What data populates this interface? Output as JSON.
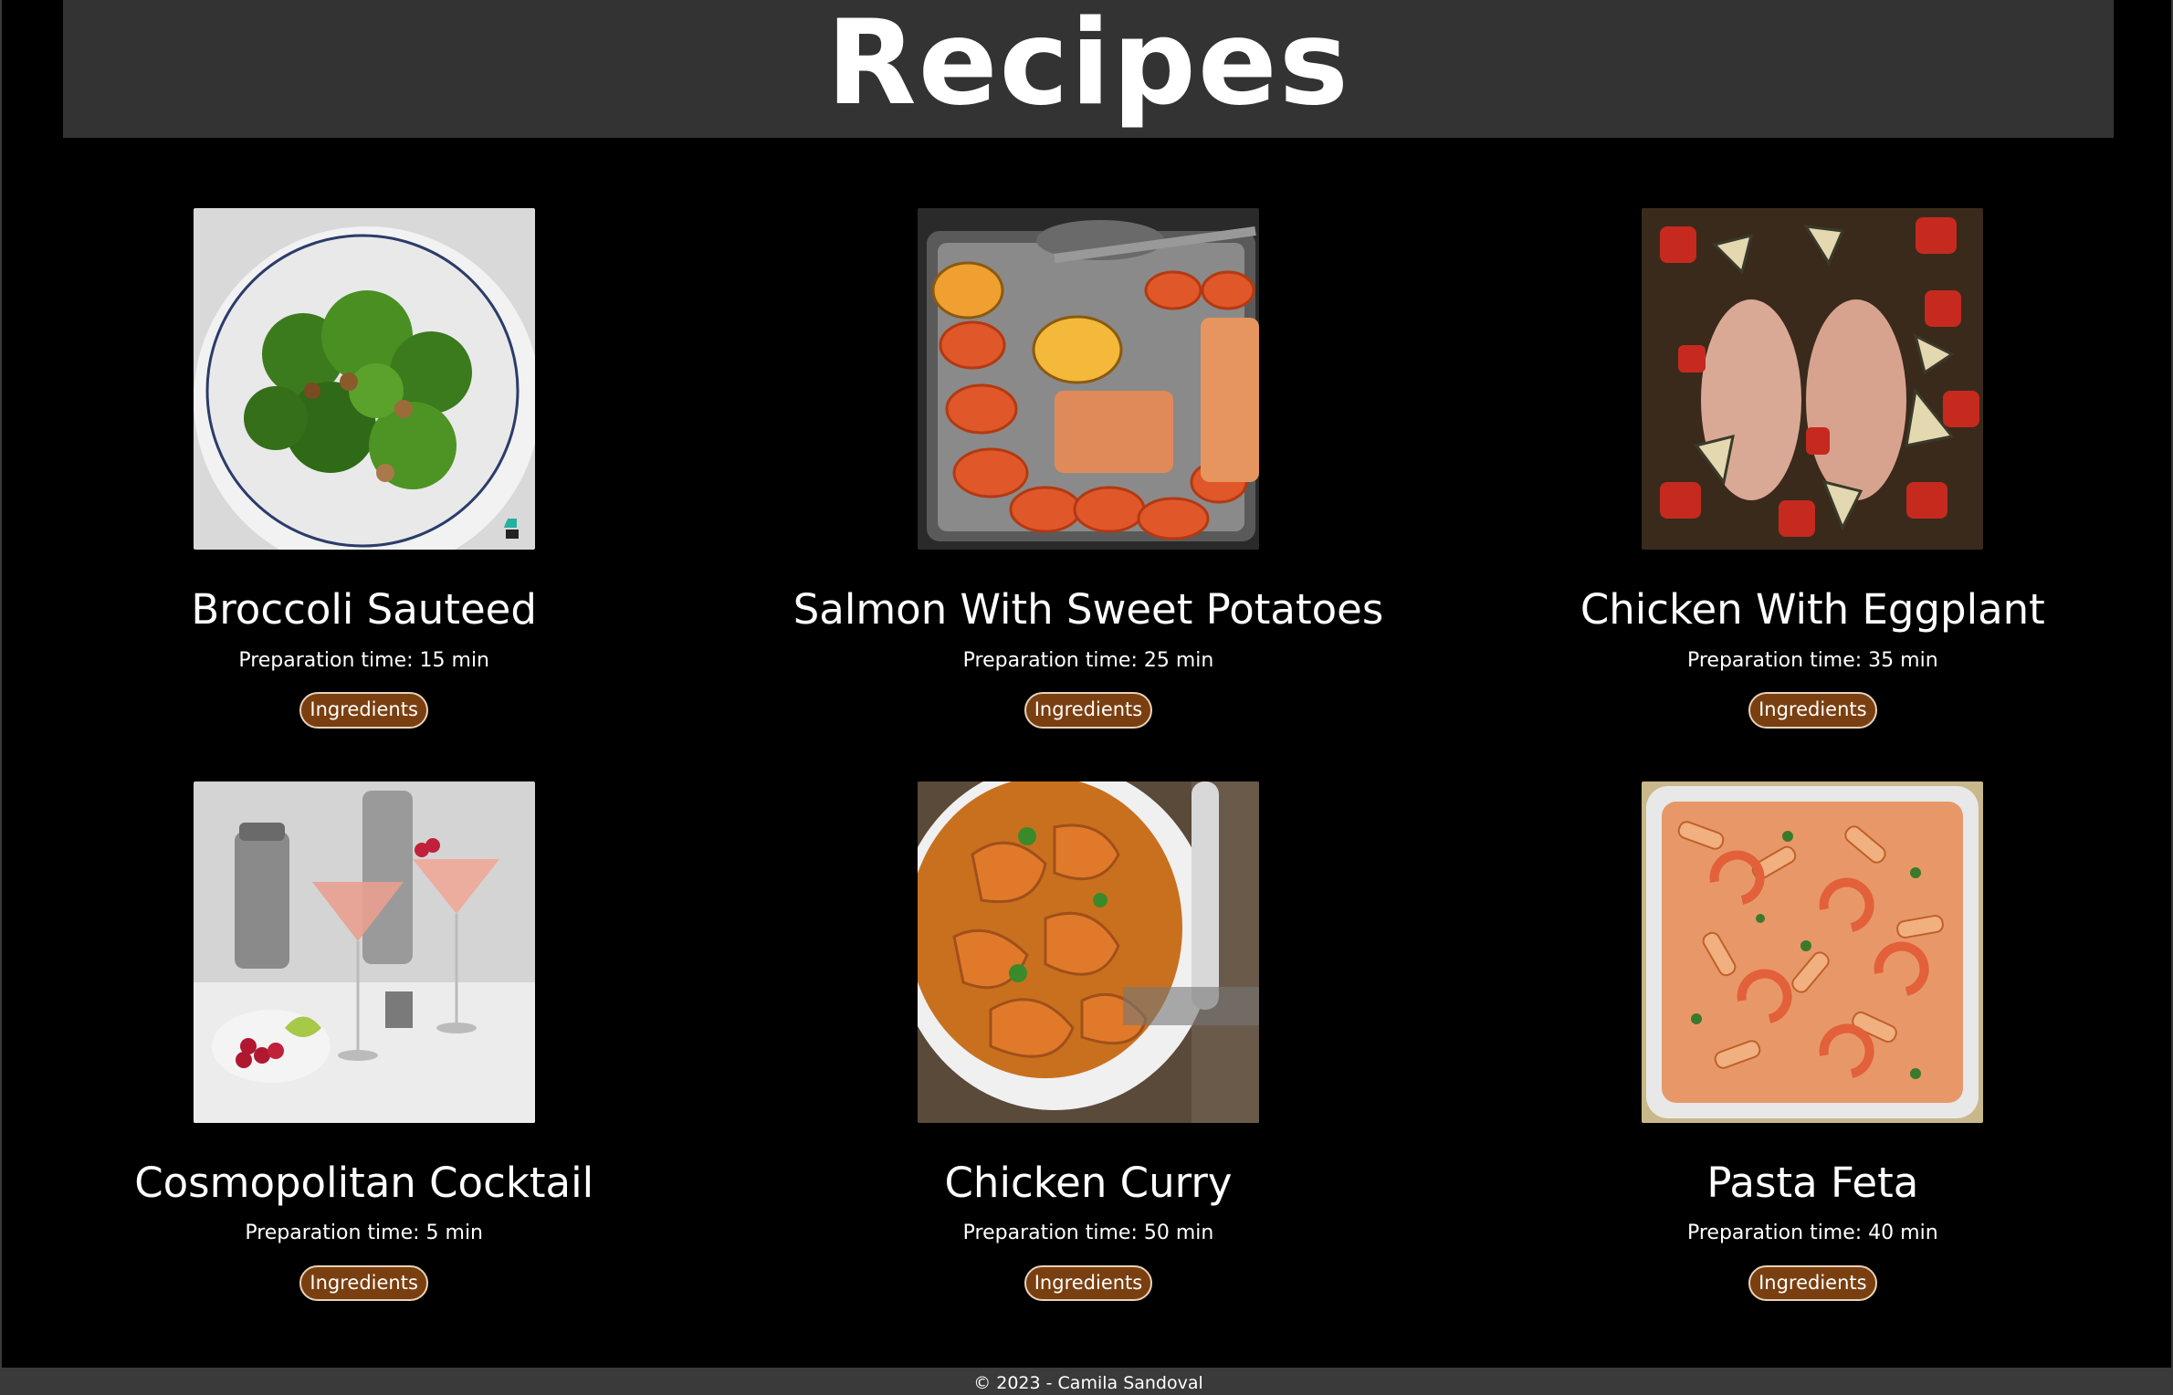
{
  "header": {
    "title": "Recipes"
  },
  "recipes": [
    {
      "title": "Broccoli Sauteed",
      "prep": "Preparation time: 15 min",
      "button": "Ingredients",
      "image": "broccoli-dish"
    },
    {
      "title": "Salmon With Sweet Potatoes",
      "prep": "Preparation time: 25 min",
      "button": "Ingredients",
      "image": "salmon-tray"
    },
    {
      "title": "Chicken With Eggplant",
      "prep": "Preparation time: 35 min",
      "button": "Ingredients",
      "image": "chicken-eggplant"
    },
    {
      "title": "Cosmopolitan Cocktail",
      "prep": "Preparation time: 5 min",
      "button": "Ingredients",
      "image": "cocktails"
    },
    {
      "title": "Chicken Curry",
      "prep": "Preparation time: 50 min",
      "button": "Ingredients",
      "image": "curry-bowl"
    },
    {
      "title": "Pasta Feta",
      "prep": "Preparation time: 40 min",
      "button": "Ingredients",
      "image": "pasta-tray"
    }
  ],
  "footer": {
    "text": "© 2023 - Camila Sandoval"
  },
  "colors": {
    "background": "#000000",
    "header": "#333333",
    "button": "#7a3f10",
    "button_border": "#e8d2b8"
  }
}
